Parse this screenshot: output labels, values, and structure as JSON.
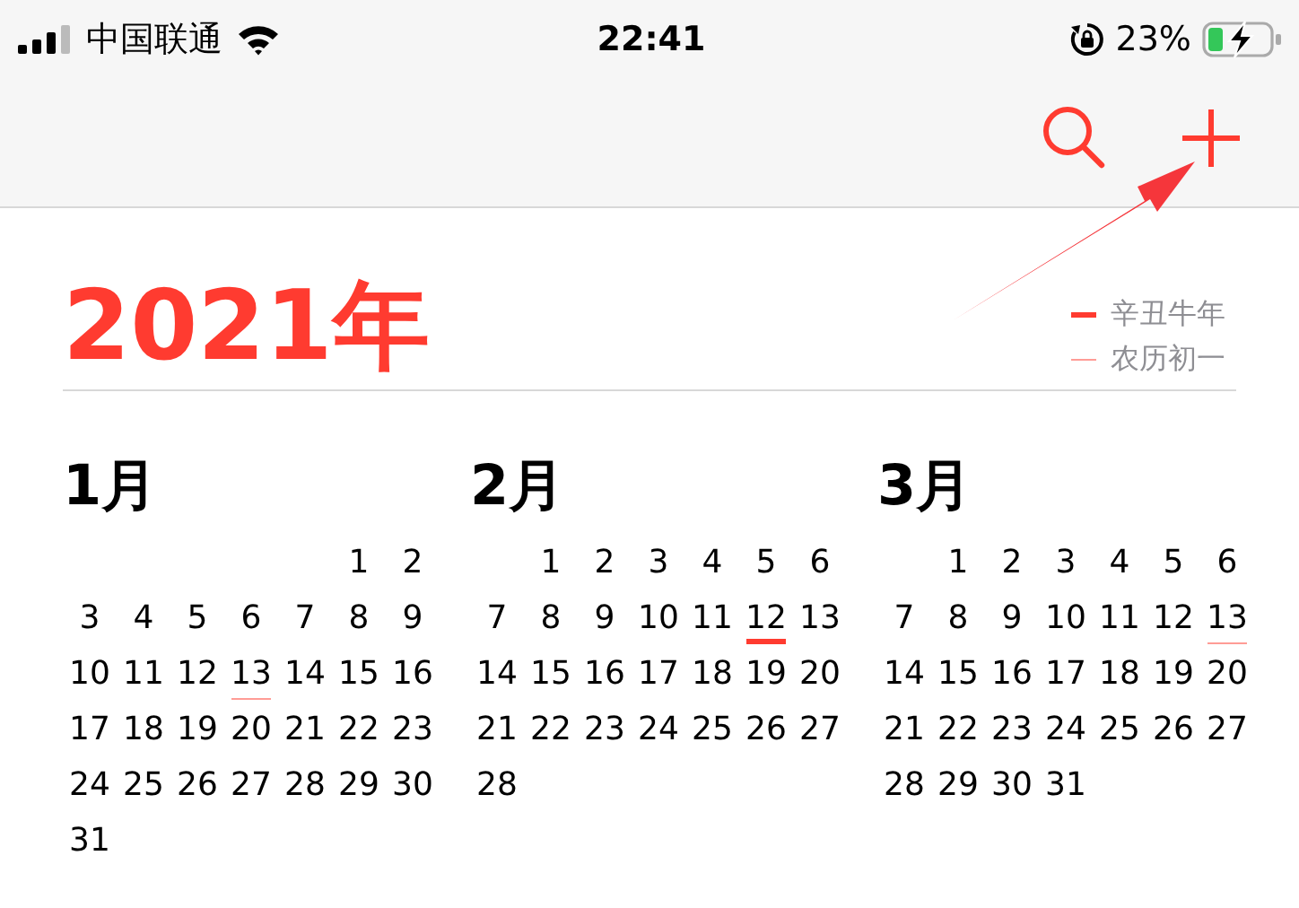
{
  "status_bar": {
    "carrier": "中国联通",
    "time": "22:41",
    "battery": "23%"
  },
  "year_title": "2021年",
  "legend": [
    {
      "kind": "new_year",
      "label": "辛丑牛年"
    },
    {
      "kind": "lunar_first",
      "label": "农历初一"
    }
  ],
  "months": [
    {
      "title": "1月",
      "weeks": [
        [
          {
            "t": "1"
          },
          {
            "t": "2"
          }
        ],
        [
          {
            "t": "3"
          },
          {
            "t": "4"
          },
          {
            "t": "5"
          },
          {
            "t": "6"
          },
          {
            "t": "7"
          },
          {
            "t": "8"
          },
          {
            "t": "9"
          }
        ],
        [
          {
            "t": "10"
          },
          {
            "t": "11"
          },
          {
            "t": "12"
          },
          {
            "t": "13",
            "kind": "lunar_first"
          },
          {
            "t": "14"
          },
          {
            "t": "15"
          },
          {
            "t": "16"
          }
        ],
        [
          {
            "t": "17"
          },
          {
            "t": "18"
          },
          {
            "t": "19"
          },
          {
            "t": "20"
          },
          {
            "t": "21"
          },
          {
            "t": "22"
          },
          {
            "t": "23"
          }
        ],
        [
          {
            "t": "24"
          },
          {
            "t": "25"
          },
          {
            "t": "26"
          },
          {
            "t": "27"
          },
          {
            "t": "28"
          },
          {
            "t": "29"
          },
          {
            "t": "30"
          }
        ],
        [
          {
            "t": "31"
          }
        ]
      ]
    },
    {
      "title": "2月",
      "weeks": [
        [
          {
            "t": "1"
          },
          {
            "t": "2"
          },
          {
            "t": "3"
          },
          {
            "t": "4"
          },
          {
            "t": "5"
          },
          {
            "t": "6"
          }
        ],
        [
          {
            "t": "7"
          },
          {
            "t": "8"
          },
          {
            "t": "9"
          },
          {
            "t": "10"
          },
          {
            "t": "11"
          },
          {
            "t": "12",
            "kind": "new_year"
          },
          {
            "t": "13"
          }
        ],
        [
          {
            "t": "14"
          },
          {
            "t": "15"
          },
          {
            "t": "16"
          },
          {
            "t": "17"
          },
          {
            "t": "18"
          },
          {
            "t": "19"
          },
          {
            "t": "20"
          }
        ],
        [
          {
            "t": "21"
          },
          {
            "t": "22"
          },
          {
            "t": "23"
          },
          {
            "t": "24"
          },
          {
            "t": "25"
          },
          {
            "t": "26"
          },
          {
            "t": "27"
          }
        ],
        [
          {
            "t": "28"
          }
        ]
      ]
    },
    {
      "title": "3月",
      "weeks": [
        [
          {
            "t": "1"
          },
          {
            "t": "2"
          },
          {
            "t": "3"
          },
          {
            "t": "4"
          },
          {
            "t": "5"
          },
          {
            "t": "6"
          }
        ],
        [
          {
            "t": "7"
          },
          {
            "t": "8"
          },
          {
            "t": "9"
          },
          {
            "t": "10"
          },
          {
            "t": "11"
          },
          {
            "t": "12"
          },
          {
            "t": "13",
            "kind": "lunar_first"
          }
        ],
        [
          {
            "t": "14"
          },
          {
            "t": "15"
          },
          {
            "t": "16"
          },
          {
            "t": "17"
          },
          {
            "t": "18"
          },
          {
            "t": "19"
          },
          {
            "t": "20"
          }
        ],
        [
          {
            "t": "21"
          },
          {
            "t": "22"
          },
          {
            "t": "23"
          },
          {
            "t": "24"
          },
          {
            "t": "25"
          },
          {
            "t": "26"
          },
          {
            "t": "27"
          }
        ],
        [
          {
            "t": "28"
          },
          {
            "t": "29"
          },
          {
            "t": "30"
          },
          {
            "t": "31"
          }
        ]
      ]
    }
  ]
}
